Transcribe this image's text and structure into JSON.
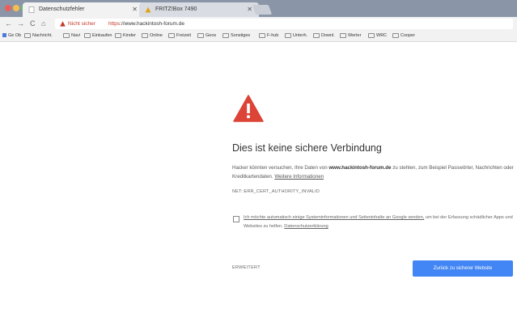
{
  "tabs": [
    {
      "label": "Datenschutzfehler",
      "active": true
    },
    {
      "label": "FRITZ!Box 7490",
      "active": false
    }
  ],
  "toolbar": {
    "back_icon": "←",
    "forward_icon": "→",
    "reload_icon": "C",
    "home_icon": "⌂",
    "security_label": "Nicht sicher",
    "url_scheme": "https",
    "url_rest": "://www.hackintosh-forum.de"
  },
  "bookmarks": [
    "Ge Ob",
    "Nachricht.",
    "Navi",
    "Einkaufen",
    "Kinder",
    "Online",
    "Freizeit",
    "Geos",
    "Sonstiges",
    "F-hub",
    "Unterh.",
    "Downl.",
    "Werter",
    "WRC",
    "Cooper"
  ],
  "interstitial": {
    "heading": "Dies ist keine sichere Verbindung",
    "body_pre": "Hacker könnten versuchen, Ihre Daten von ",
    "body_domain": "www.hackintosh-forum.de",
    "body_post": " zu stehlen, zum Beispiel Passwörter, Nachrichten oder Kreditkartendaten.",
    "more_info_link": "Weitere Informationen",
    "error_code": "NET::ERR_CERT_AUTHORITY_INVALID",
    "checkbox_text_link": "Ich möchte automatisch einige Systeminformationen und Seiteninhalte an Google senden,",
    "checkbox_text_rest": " um bei der Erfassung schädlicher Apps und Websites zu helfen.",
    "privacy_link": "Datenschutzerklärung",
    "details_button": "ERWEITERT",
    "back_button": "Zurück zu sicherer Website"
  },
  "colors": {
    "warning_red": "#db4437",
    "primary_blue": "#4285f4",
    "tabstrip": "#8a96a8",
    "toolbar": "#f2f2f2"
  }
}
